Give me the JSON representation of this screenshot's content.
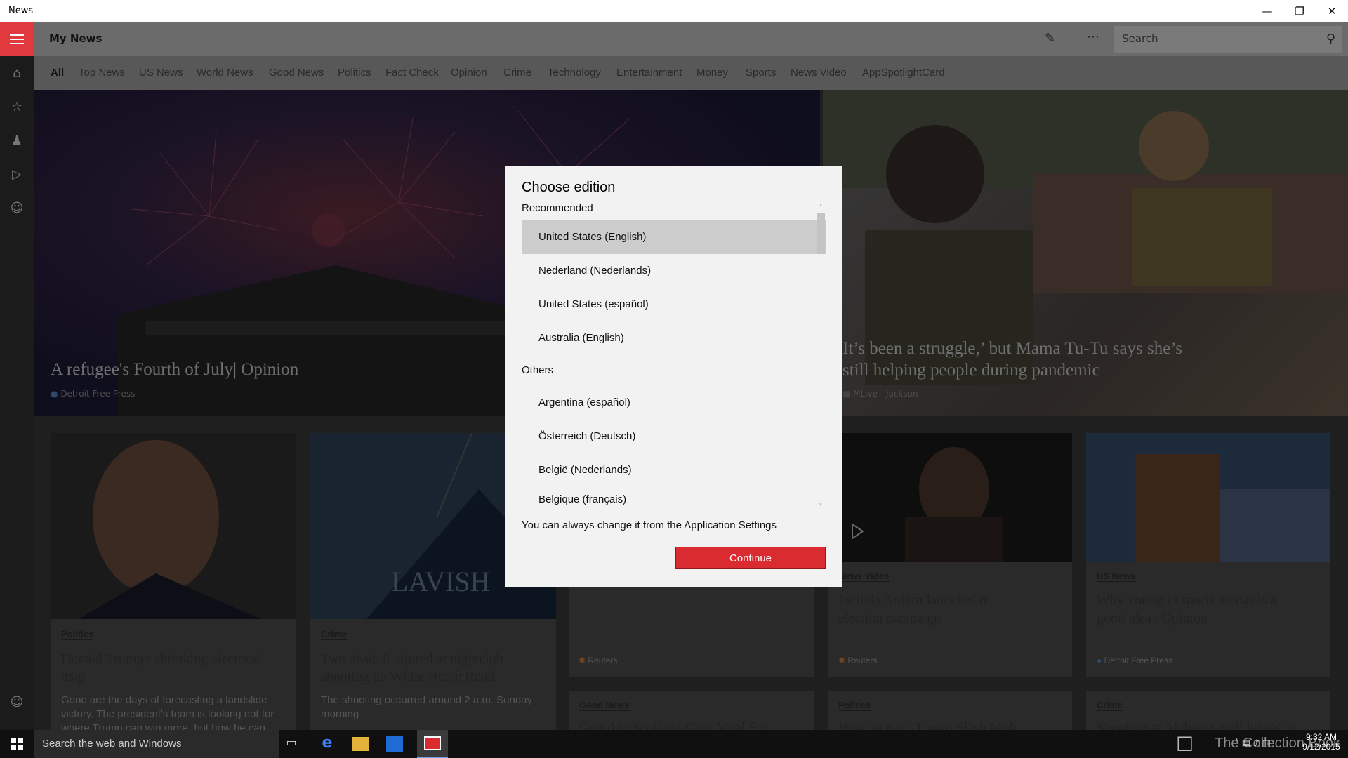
{
  "window": {
    "title": "News"
  },
  "header": {
    "title": "My News",
    "search_placeholder": "Search"
  },
  "categories": [
    "All",
    "Top News",
    "US News",
    "World News",
    "Good News",
    "Politics",
    "Fact Check",
    "Opinion",
    "Crime",
    "Technology",
    "Entertainment",
    "Money",
    "Sports",
    "News Video",
    "AppSpotlightCard"
  ],
  "hero": [
    {
      "title": "A refugee's Fourth of July| Opinion",
      "source": "Detroit Free Press"
    },
    {
      "title_line1": "It’s been a struggle,’ but Mama Tu-Tu says she’s",
      "title_line2": "still helping people during pandemic",
      "source": "MLive - Jackson"
    }
  ],
  "cards": [
    {
      "tag": "Politics",
      "title_line1": "Donald Trump's shrinking electoral",
      "title_line2": "map",
      "desc_line1": "Gone are the days of forecasting a landslide",
      "desc_line2": "victory. The president's team is looking not for",
      "desc_line3": "where Trump can win more, but how he can"
    },
    {
      "tag": "Crime",
      "title_line1": "Two dead, 8 injured at nightclub",
      "title_line2": "shooting on White Horse Road",
      "desc_line1": "The shooting occurred around 2 a.m. Sunday",
      "desc_line2": "morning",
      "image_text": "LAVISH"
    },
    {
      "source": "Reuters"
    },
    {
      "tag": "News Video",
      "title_line1": "Jacinda Ardern launches re-",
      "title_line2": "election campaign",
      "source": "Reuters"
    },
    {
      "tag": "US News",
      "title_line1": "Why voting in sports arenas is a",
      "title_line2": "good idea | Opinion",
      "source": "Detroit Free Press"
    }
  ],
  "row3": [
    {
      "tag": "Good News",
      "title_partial": "Guard in Scotland Goes Viral For"
    },
    {
      "tag": "Politics",
      "title_partial": "How an Anti-Trump Flash Mob"
    },
    {
      "tag": "Crime",
      "title_partial": "Shooting at Alabama mall leaves an"
    }
  ],
  "dialog": {
    "title": "Choose edition",
    "recommended_label": "Recommended",
    "recommended": [
      "United States (English)",
      "Nederland (Nederlands)",
      "United States (español)",
      "Australia (English)"
    ],
    "others_label": "Others",
    "others": [
      "Argentina (español)",
      "Österreich (Deutsch)",
      "België (Nederlands)",
      "Belgique (français)"
    ],
    "note": "You can always change it from the Application Settings",
    "continue_label": "Continue",
    "selected_index": 0
  },
  "taskbar": {
    "search_placeholder": "Search the web and Windows",
    "time": "9:32 AM",
    "date": "9/12/2015",
    "watermark": "The Collection Book"
  },
  "colors": {
    "accent": "#e03a3e",
    "button": "#d92b30"
  }
}
